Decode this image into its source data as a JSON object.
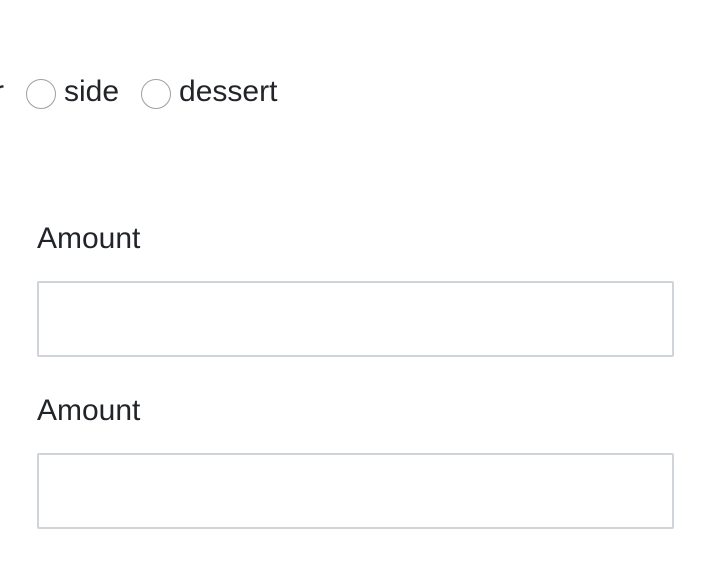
{
  "course_options": {
    "clipped_fragment": "r",
    "items": [
      {
        "label": "side",
        "checked": false
      },
      {
        "label": "dessert",
        "checked": false
      }
    ]
  },
  "fields": [
    {
      "label": "Amount",
      "value": "",
      "placeholder": ""
    },
    {
      "label": "Amount",
      "value": "",
      "placeholder": ""
    }
  ]
}
